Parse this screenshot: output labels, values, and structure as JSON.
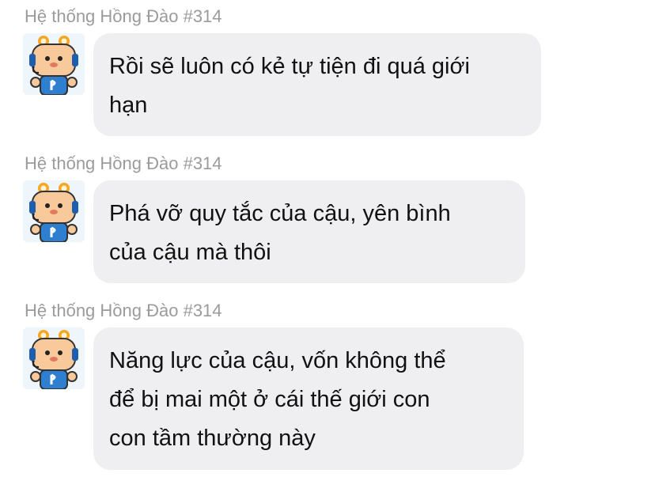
{
  "messages": [
    {
      "sender": "Hệ thống Hồng Đào #314",
      "lines": [
        "Rồi sẽ luôn có kẻ tự tiện đi quá giới",
        "hạn"
      ]
    },
    {
      "sender": "Hệ thống Hồng Đào #314",
      "lines": [
        "Phá vỡ quy tắc của cậu, yên bình",
        "của cậu mà thôi"
      ]
    },
    {
      "sender": "Hệ thống Hồng Đào #314",
      "lines": [
        "Năng lực của cậu, vốn không thể",
        "để bị mai một ở cái thế giới con",
        "con tầm thường này"
      ]
    }
  ],
  "colors": {
    "bubble": "#efeff1",
    "sender_text": "#9b9b9b",
    "message_text": "#111111"
  },
  "icons": {
    "avatar": "robot-mascot-avatar-icon"
  }
}
